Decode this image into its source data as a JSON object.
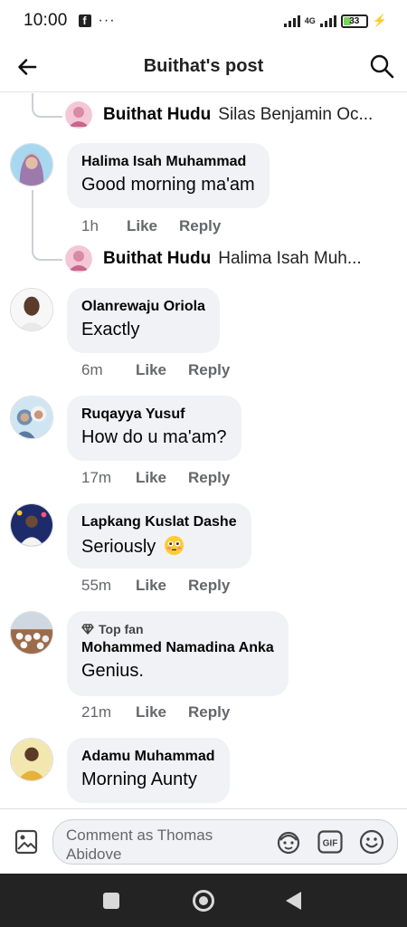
{
  "status_bar": {
    "time": "10:00",
    "dots": "···",
    "network": "4G",
    "battery": "33"
  },
  "header": {
    "title": "Buithat's post"
  },
  "colors": {
    "bubble": "#f0f2f5",
    "meta": "#65676b",
    "thread_line": "#ccd0d5"
  },
  "replies": [
    {
      "author": "Buithat Hudu",
      "text": "Silas Benjamin Oc..."
    },
    {
      "author": "Buithat Hudu",
      "text": "Halima Isah Muh..."
    }
  ],
  "comments": [
    {
      "author": "Halima Isah Muhammad",
      "text": "Good morning ma'am",
      "time": "1h",
      "like": "Like",
      "reply": "Reply"
    },
    {
      "author": "Olanrewaju Oriola",
      "text": "Exactly",
      "time": "6m",
      "like": "Like",
      "reply": "Reply"
    },
    {
      "author": "Ruqayya Yusuf",
      "text": "How do u ma'am?",
      "time": "17m",
      "like": "Like",
      "reply": "Reply"
    },
    {
      "author": "Lapkang Kuslat Dashe",
      "text": "Seriously",
      "time": "55m",
      "like": "Like",
      "reply": "Reply"
    },
    {
      "badge": "Top fan",
      "author": "Mohammed Namadina Anka",
      "text": "Genius.",
      "time": "21m",
      "like": "Like",
      "reply": "Reply"
    },
    {
      "author": "Adamu Muhammad",
      "text": "Morning Aunty"
    }
  ],
  "composer": {
    "placeholder": "Comment as Thomas Abidove",
    "gif_label": "GIF"
  }
}
